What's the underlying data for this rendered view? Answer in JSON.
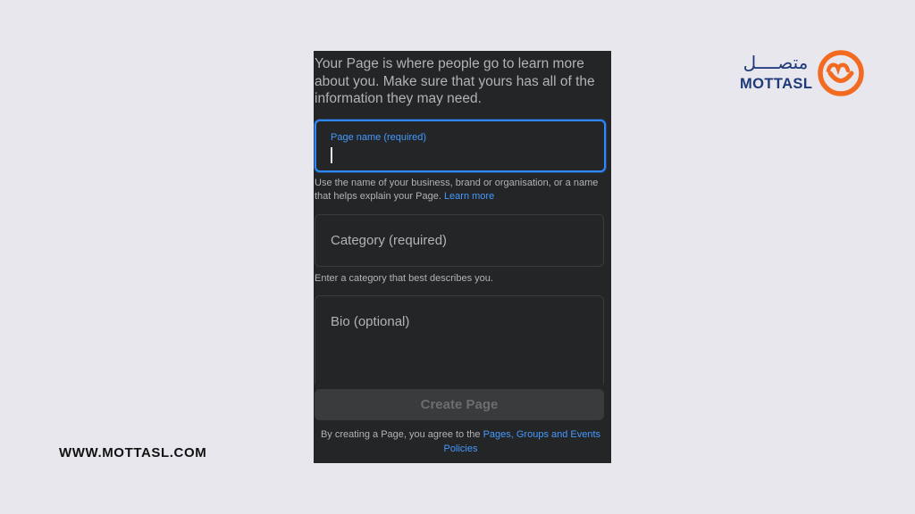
{
  "form": {
    "intro": "Your Page is where people go to learn more about you. Make sure that yours has all of the information they may need.",
    "page_name": {
      "label": "Page name (required)",
      "value": "",
      "help_text": "Use the name of your business, brand or organisation, or a name that helps explain your Page.",
      "help_link": "Learn more"
    },
    "category": {
      "placeholder": "Category (required)",
      "help_text": "Enter a category that best describes you."
    },
    "bio": {
      "placeholder": "Bio (optional)"
    },
    "create_button": "Create Page",
    "terms": {
      "prefix": "By creating a Page, you agree to the",
      "link": "Pages, Groups and Events Policies"
    }
  },
  "website": "WWW.MOTTASL.COM",
  "logo": {
    "arabic": "متصــــل",
    "english": "MOTTASL",
    "icon": "smile-heart-logo-icon"
  },
  "colors": {
    "panel_bg": "#242526",
    "accent_blue": "#2d88ff",
    "link_blue": "#4599ff",
    "brand_navy": "#1f3a7a",
    "brand_orange": "#f36b21",
    "page_bg": "#e9e7ee"
  }
}
